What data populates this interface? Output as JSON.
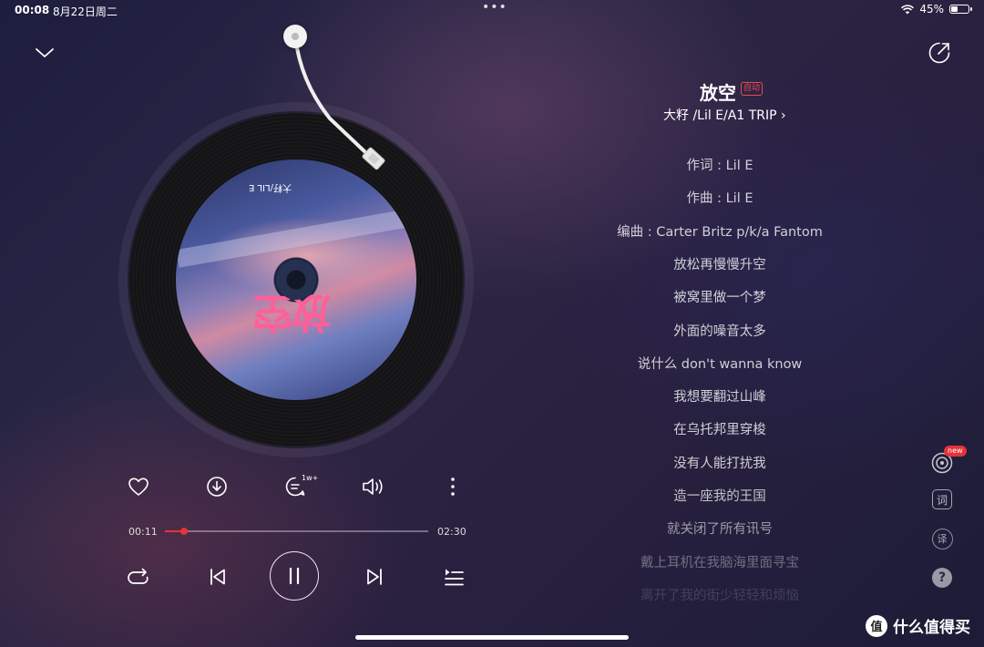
{
  "status_bar": {
    "time": "00:08",
    "date": "8月22日周二",
    "dots": "•••",
    "battery_text": "45%",
    "battery_level": 0.45
  },
  "header": {
    "collapse_icon": "chevron-down-icon",
    "share_icon": "share-icon"
  },
  "song": {
    "title": "放空",
    "quality_badge": "自动",
    "artist_line": "大籽 /Lil E/A1 TRIP",
    "artist_chevron": "›"
  },
  "album_cover": {
    "title_text": "放空",
    "small_text": "大籽/LIL E"
  },
  "lyrics": [
    {
      "text": "作词 : Lil E",
      "opacity": 0.78
    },
    {
      "text": "作曲 : Lil E",
      "opacity": 0.78
    },
    {
      "text": "编曲 : Carter Britz p/k/a Fantom",
      "opacity": 0.78
    },
    {
      "text": "放松再慢慢升空",
      "opacity": 0.78
    },
    {
      "text": "被窝里做一个梦",
      "opacity": 0.78
    },
    {
      "text": "外面的噪音太多",
      "opacity": 0.78
    },
    {
      "text": "说什么 don't wanna know",
      "opacity": 0.78
    },
    {
      "text": "我想要翻过山峰",
      "opacity": 0.78
    },
    {
      "text": "在乌托邦里穿梭",
      "opacity": 0.78
    },
    {
      "text": "没有人能打扰我",
      "opacity": 0.78
    },
    {
      "text": "造一座我的王国",
      "opacity": 0.72
    },
    {
      "text": "就关闭了所有讯号",
      "opacity": 0.55
    },
    {
      "text": "戴上耳机在我脑海里面寻宝",
      "opacity": 0.35
    },
    {
      "text": "离开了我的街少轻轻和烦恼",
      "opacity": 0.15
    }
  ],
  "actions": {
    "like_icon": "heart-icon",
    "download_icon": "download-icon",
    "comment_icon": "comment-icon",
    "comment_count": "1w+",
    "sound_icon": "sound-effect-icon",
    "more_icon": "more-icon"
  },
  "progress": {
    "current": "00:11",
    "total": "02:30",
    "fraction": 0.073
  },
  "transport": {
    "repeat_icon": "repeat-icon",
    "prev_icon": "previous-icon",
    "play_icon": "pause-icon",
    "next_icon": "next-icon",
    "playlist_icon": "playlist-icon"
  },
  "side_panel": {
    "new_badge": "new",
    "lyric_btn": "词",
    "translate_btn": "译",
    "help_btn": "?"
  },
  "watermark": {
    "logo": "值",
    "text": "什么值得买"
  }
}
